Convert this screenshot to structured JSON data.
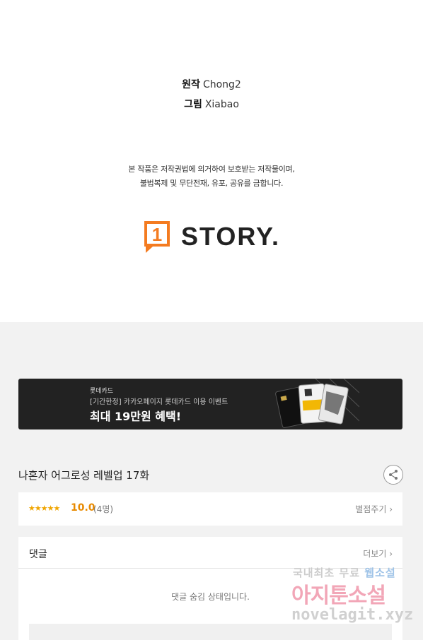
{
  "credits": {
    "original_label": "원작",
    "original_name": "Chong2",
    "art_label": "그림",
    "art_name": "Xiabao"
  },
  "notice": {
    "line1": "본 작품은 저작권법에 의거하여 보호받는 저작물이며,",
    "line2": "불법복제 및 무단전재, 유포, 공유를 금합니다."
  },
  "logo": {
    "mark": "1",
    "word": "STORY.",
    "accent_color": "#f47b20"
  },
  "banner": {
    "brand": "롯데카드",
    "subtitle": "[기간한정] 카카오페이지 롯데카드 이용 이벤트",
    "headline": "최대 19만원 혜택!"
  },
  "episode": {
    "title": "나혼자 어그로성 레벨업 17화",
    "share_icon": "share-icon"
  },
  "rating": {
    "stars": "★★★★★",
    "score": "10.0",
    "count": "(4명)",
    "rate_label": "별점주기",
    "star_color": "#f0a500"
  },
  "comments": {
    "label": "댓글",
    "more_label": "더보기",
    "hidden_message": "댓글 숨김 상태입니다."
  },
  "watermark": {
    "line1_a": "국내최초 무료",
    "line1_b": "웹소설",
    "line2": "아지툰소설",
    "line3": "novelagit.xyz"
  }
}
